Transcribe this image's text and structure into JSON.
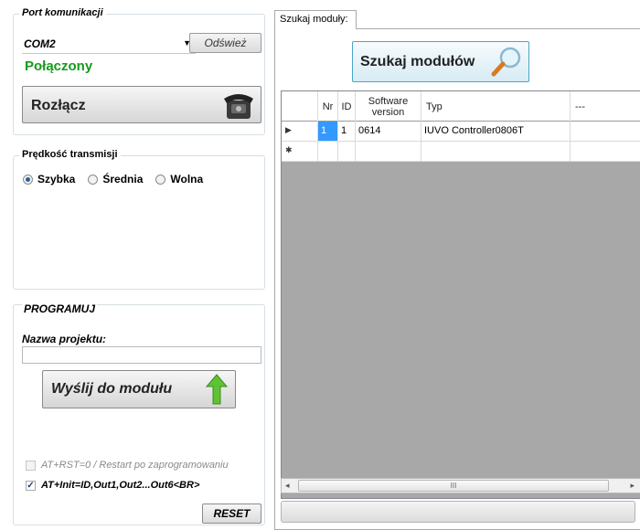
{
  "port": {
    "title": "Port komunikacji",
    "com_value": "COM2",
    "refresh_label": "Odśwież",
    "status": "Połączony",
    "disconnect_label": "Rozłącz"
  },
  "speed": {
    "title": "Prędkość transmisji",
    "options": [
      {
        "label": "Szybka",
        "selected": true
      },
      {
        "label": "Średnia",
        "selected": false
      },
      {
        "label": "Wolna",
        "selected": false
      }
    ]
  },
  "program": {
    "title": "PROGRAMUJ",
    "project_label": "Nazwa projektu:",
    "project_value": "",
    "send_label": "Wyślij do modułu",
    "restart_label": "AT+RST=0 / Restart po zaprogramowaniu",
    "restart_checked": false,
    "init_label": "AT+Init=ID,Out1,Out2...Out6<BR>",
    "init_checked": true,
    "reset_label": "RESET"
  },
  "search_tab": {
    "tab_label": "Szukaj moduły:",
    "search_button_label": "Szukaj modułów",
    "columns": [
      "Nr",
      "ID",
      "Software version",
      "Typ",
      "---"
    ],
    "rows": [
      {
        "marker": "▶",
        "nr": "1",
        "id": "1",
        "software": "0614",
        "typ": "IUVO Controller0806T",
        "extra": ""
      }
    ],
    "new_row_marker": "✱",
    "scroll_thumb_glyph": "III",
    "scroll_left": "◂",
    "scroll_right": "▸"
  },
  "colors": {
    "status_green": "#179a1e",
    "selection_blue": "#3399ff",
    "grid_background": "#a8a8a8",
    "search_button_border": "#4ba3c8"
  }
}
